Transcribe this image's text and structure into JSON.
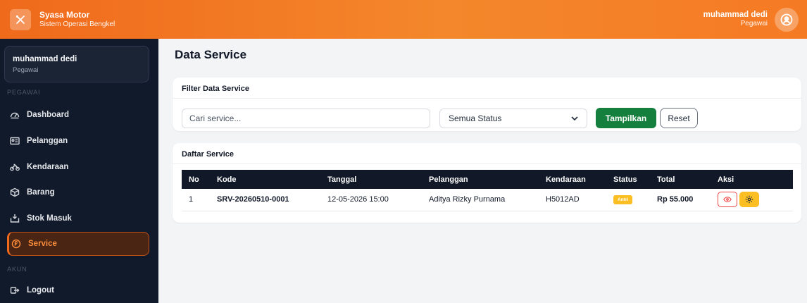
{
  "app": {
    "name": "Syasa Motor",
    "subtitle": "Sistem Operasi Bengkel"
  },
  "header_user": {
    "name": "muhammad dedi",
    "role": "Pegawai"
  },
  "sidebar": {
    "user": {
      "name": "muhammad dedi",
      "role": "Pegawai"
    },
    "section_main": "PEGAWAI",
    "items": [
      {
        "label": "Dashboard",
        "icon": "dashboard-icon"
      },
      {
        "label": "Pelanggan",
        "icon": "id-card-icon"
      },
      {
        "label": "Kendaraan",
        "icon": "motorcycle-icon"
      },
      {
        "label": "Barang",
        "icon": "box-icon"
      },
      {
        "label": "Stok Masuk",
        "icon": "inbox-icon"
      },
      {
        "label": "Service",
        "icon": "service-icon",
        "active": true
      }
    ],
    "section_account": "AKUN",
    "logout": {
      "label": "Logout",
      "icon": "logout-icon"
    }
  },
  "page": {
    "title": "Data Service"
  },
  "filter": {
    "title": "Filter Data Service",
    "search_placeholder": "Cari service...",
    "status_value": "Semua Status",
    "show_label": "Tampilkan",
    "reset_label": "Reset"
  },
  "list": {
    "title": "Daftar Service",
    "columns": [
      "No",
      "Kode",
      "Tanggal",
      "Pelanggan",
      "Kendaraan",
      "Status",
      "Total",
      "Aksi"
    ],
    "rows": [
      {
        "no": "1",
        "kode": "SRV-20260510-0001",
        "tanggal": "12-05-2026 15:00",
        "pelanggan": "Aditya Rizky Purnama",
        "kendaraan": "H5012AD",
        "status": "Antri",
        "total": "Rp 55.000"
      }
    ]
  },
  "colors": {
    "accent": "#f06a1c",
    "sidebar": "#111a2a",
    "success": "#15803d",
    "warning": "#fbbf24",
    "danger": "#ef4444"
  }
}
